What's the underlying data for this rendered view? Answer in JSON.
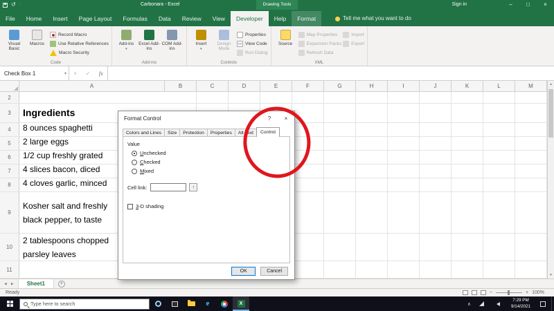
{
  "titlebar": {
    "title": "Carbonara - Excel",
    "context_group": "Drawing Tools",
    "sign_in": "Sign in",
    "minimize": "–",
    "maximize": "□",
    "close": "×"
  },
  "tabs": {
    "file": "File",
    "home": "Home",
    "insert": "Insert",
    "page_layout": "Page Layout",
    "formulas": "Formulas",
    "data": "Data",
    "review": "Review",
    "view": "View",
    "developer": "Developer",
    "help": "Help",
    "format": "Format",
    "tell_me": "Tell me what you want to do"
  },
  "ribbon": {
    "code": {
      "name": "Code",
      "visual_basic": "Visual Basic",
      "macros": "Macros",
      "record_macro": "Record Macro",
      "use_relative_references": "Use Relative References",
      "macro_security": "Macro Security"
    },
    "addins": {
      "name": "Add-ins",
      "addins": "Add-ins",
      "excel_addins": "Excel Add-ins",
      "com_addins": "COM Add-ins"
    },
    "controls": {
      "name": "Controls",
      "insert": "Insert",
      "design_mode": "Design Mode",
      "properties": "Properties",
      "view_code": "View Code",
      "run_dialog": "Run Dialog"
    },
    "xml": {
      "name": "XML",
      "source": "Source",
      "map_properties": "Map Properties",
      "expansion_packs": "Expansion Packs",
      "refresh_data": "Refresh Data",
      "import": "Import",
      "export": "Export"
    }
  },
  "formula_bar": {
    "name_box": "Check Box 1",
    "formula": ""
  },
  "grid": {
    "cols": [
      "A",
      "B",
      "C",
      "D",
      "E",
      "F",
      "G",
      "H",
      "I",
      "J",
      "K",
      "L",
      "M"
    ],
    "rows": [
      {
        "num": "2",
        "l1": "",
        "l2": ""
      },
      {
        "num": "3",
        "l1": "Ingredients",
        "l2": ""
      },
      {
        "num": "4",
        "l1": "8 ounces spaghetti",
        "l2": ""
      },
      {
        "num": "5",
        "l1": "2 large eggs",
        "l2": ""
      },
      {
        "num": "6",
        "l1": "1/2 cup freshly grated",
        "l2": ""
      },
      {
        "num": "7",
        "l1": "4 slices bacon, diced",
        "l2": ""
      },
      {
        "num": "8",
        "l1": "4 cloves garlic, minced",
        "l2": ""
      },
      {
        "num": "9",
        "l1": "Kosher salt and freshly",
        "l2": "black pepper, to taste"
      },
      {
        "num": "10",
        "l1": "2 tablespoons chopped",
        "l2": "parsley leaves"
      },
      {
        "num": "11",
        "l1": "",
        "l2": ""
      }
    ]
  },
  "dialog": {
    "title": "Format Control",
    "help": "?",
    "close": "×",
    "tabs": {
      "colors": "Colors and Lines",
      "size": "Size",
      "protection": "Protection",
      "properties": "Properties",
      "alt_text": "Alt Text",
      "control": "Control"
    },
    "value_label": "Value",
    "radio_unchecked": "Unchecked",
    "radio_checked": "Checked",
    "radio_mixed": "Mixed",
    "cell_link_label": "Cell link:",
    "cell_link_value": "",
    "collapse_arrow": "↑",
    "shading_label": "3-D shading",
    "ok": "OK",
    "cancel": "Cancel"
  },
  "sheet_bar": {
    "sheet1": "Sheet1"
  },
  "status_bar": {
    "mode": "Ready",
    "zoom": "100%"
  },
  "taskbar": {
    "search_placeholder": "Type here to search",
    "time": "7:29 PM",
    "date": "9/14/2021"
  },
  "colors": {
    "excel_green": "#217346",
    "annotation_red": "#e0161d"
  }
}
